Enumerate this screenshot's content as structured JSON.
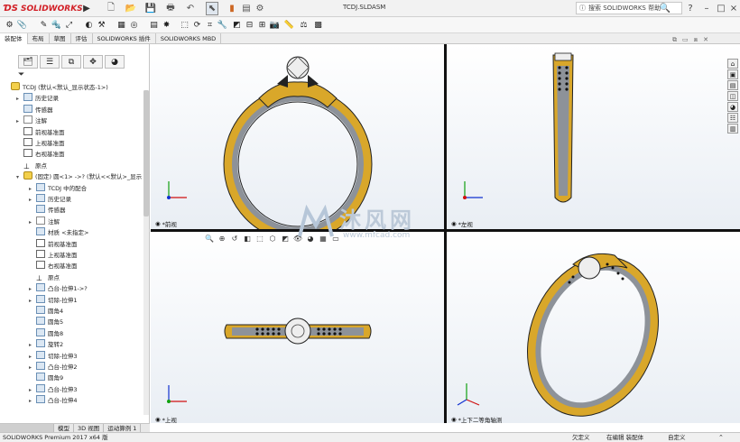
{
  "titlebar": {
    "brand": "SOLIDWORKS",
    "document_title": "TCDJ.SLDASM",
    "search_placeholder": "搜索 SOLIDWORKS 帮助",
    "help_label": "?",
    "minimize": "–",
    "restore": "□",
    "close": "×"
  },
  "tabs": [
    "装配体",
    "布局",
    "草图",
    "评估",
    "SOLIDWORKS 插件",
    "SOLIDWORKS MBD"
  ],
  "active_tab": 0,
  "tree": [
    {
      "label": "TCDJ  (默认<默认_显示状态-1>)",
      "indent": 0,
      "arrow": "",
      "icon": "yellow"
    },
    {
      "label": "历史记录",
      "indent": 1,
      "arrow": "▸",
      "icon": "feat"
    },
    {
      "label": "传感器",
      "indent": 1,
      "arrow": "",
      "icon": "feat"
    },
    {
      "label": "注解",
      "indent": 1,
      "arrow": "▸",
      "icon": "note"
    },
    {
      "label": "前视基准面",
      "indent": 1,
      "arrow": "",
      "icon": "plane"
    },
    {
      "label": "上视基准面",
      "indent": 1,
      "arrow": "",
      "icon": "plane"
    },
    {
      "label": "右视基准面",
      "indent": 1,
      "arrow": "",
      "icon": "plane"
    },
    {
      "label": "原点",
      "indent": 1,
      "arrow": "",
      "icon": "origin"
    },
    {
      "label": "(固定) 圆<1> ->? (默认<<默认>_显示",
      "indent": 1,
      "arrow": "▾",
      "icon": "yellow"
    },
    {
      "label": "TCDJ 中的配合",
      "indent": 2,
      "arrow": "▸",
      "icon": "feat"
    },
    {
      "label": "历史记录",
      "indent": 2,
      "arrow": "▸",
      "icon": "feat"
    },
    {
      "label": "传感器",
      "indent": 2,
      "arrow": "",
      "icon": "feat"
    },
    {
      "label": "注解",
      "indent": 2,
      "arrow": "▸",
      "icon": "note"
    },
    {
      "label": "材质 <未指定>",
      "indent": 2,
      "arrow": "",
      "icon": "feat"
    },
    {
      "label": "前视基准面",
      "indent": 2,
      "arrow": "",
      "icon": "plane"
    },
    {
      "label": "上视基准面",
      "indent": 2,
      "arrow": "",
      "icon": "plane"
    },
    {
      "label": "右视基准面",
      "indent": 2,
      "arrow": "",
      "icon": "plane"
    },
    {
      "label": "原点",
      "indent": 2,
      "arrow": "",
      "icon": "origin"
    },
    {
      "label": "凸台-拉伸1->?",
      "indent": 2,
      "arrow": "▸",
      "icon": "feat"
    },
    {
      "label": "切除-拉伸1",
      "indent": 2,
      "arrow": "▸",
      "icon": "feat"
    },
    {
      "label": "圆角4",
      "indent": 2,
      "arrow": "",
      "icon": "feat"
    },
    {
      "label": "圆角5",
      "indent": 2,
      "arrow": "",
      "icon": "feat"
    },
    {
      "label": "圆角8",
      "indent": 2,
      "arrow": "",
      "icon": "feat"
    },
    {
      "label": "旋转2",
      "indent": 2,
      "arrow": "▸",
      "icon": "feat"
    },
    {
      "label": "切除-拉伸3",
      "indent": 2,
      "arrow": "▸",
      "icon": "feat"
    },
    {
      "label": "凸台-拉伸2",
      "indent": 2,
      "arrow": "▸",
      "icon": "feat"
    },
    {
      "label": "圆角9",
      "indent": 2,
      "arrow": "",
      "icon": "feat"
    },
    {
      "label": "凸台-拉伸3",
      "indent": 2,
      "arrow": "▸",
      "icon": "feat"
    },
    {
      "label": "凸台-拉伸4",
      "indent": 2,
      "arrow": "▸",
      "icon": "feat"
    }
  ],
  "bottom_tabs": [
    "模型",
    "3D 视图",
    "运动算例 1"
  ],
  "viewports": {
    "front": "*前视",
    "left": "*左视",
    "top": "*上视",
    "iso": "*上下二等角轴测"
  },
  "statusbar": {
    "product": "SOLIDWORKS Premium 2017 x64 版",
    "state": "欠定义",
    "mode": "在编辑 装配体",
    "custom": "自定义"
  },
  "watermark": {
    "text": "沐风网",
    "url": "www.mfcad.com"
  },
  "colors": {
    "gold": "#d9a72a",
    "silver": "#8d9299",
    "accent": "#d21f26",
    "axis_x": "#d01010",
    "axis_y": "#10a010",
    "axis_z": "#1030d0"
  }
}
